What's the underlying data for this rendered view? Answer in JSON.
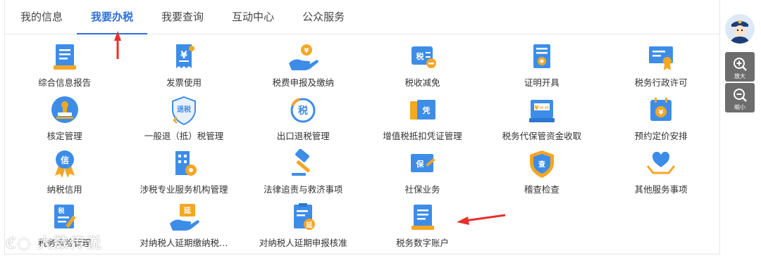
{
  "tabs": [
    {
      "label": "我的信息"
    },
    {
      "label": "我要办税"
    },
    {
      "label": "我要查询"
    },
    {
      "label": "互动中心"
    },
    {
      "label": "公众服务"
    }
  ],
  "items": [
    {
      "label": "综合信息报告",
      "icon": "report-document-icon"
    },
    {
      "label": "发票使用",
      "icon": "invoice-yen-icon"
    },
    {
      "label": "税费申报及缴纳",
      "icon": "hand-coin-icon"
    },
    {
      "label": "税收减免",
      "icon": "tax-reduction-icon"
    },
    {
      "label": "证明开具",
      "icon": "certificate-icon"
    },
    {
      "label": "税务行政许可",
      "icon": "license-award-icon"
    },
    {
      "label": "核定管理",
      "icon": "stamp-icon"
    },
    {
      "label": "一般退（抵）税管理",
      "icon": "tax-refund-shield-icon"
    },
    {
      "label": "出口退税管理",
      "icon": "export-refund-circle-icon"
    },
    {
      "label": "增值税抵扣凭证管理",
      "icon": "voucher-ticket-icon"
    },
    {
      "label": "税务代保管资金收取",
      "icon": "safe-box-icon"
    },
    {
      "label": "预约定价安排",
      "icon": "calendar-yen-icon"
    },
    {
      "label": "纳税信用",
      "icon": "credit-medal-icon"
    },
    {
      "label": "涉税专业服务机构管理",
      "icon": "building-gear-icon"
    },
    {
      "label": "法律追责与救济事项",
      "icon": "gavel-icon"
    },
    {
      "label": "社保业务",
      "icon": "social-insurance-icon"
    },
    {
      "label": "稽查检查",
      "icon": "inspection-shield-icon"
    },
    {
      "label": "其他服务事项",
      "icon": "hand-heart-icon"
    },
    {
      "label": "税务风险管理",
      "icon": "tax-risk-document-icon"
    },
    {
      "label": "对纳税人延期缴纳税…",
      "icon": "deferred-payment-icon"
    },
    {
      "label": "对纳税人延期申报核准",
      "icon": "deferred-filing-icon"
    },
    {
      "label": "税务数字账户",
      "icon": "digital-account-icon"
    }
  ],
  "tools": {
    "zoom_in": "放大",
    "zoom_out": "缩小"
  },
  "watermark": "大数传说",
  "colors": {
    "accent": "#2c6fd6",
    "icon_blue": "#3d8de8",
    "icon_orange": "#f5a623",
    "arrow_red": "#e8302a"
  }
}
